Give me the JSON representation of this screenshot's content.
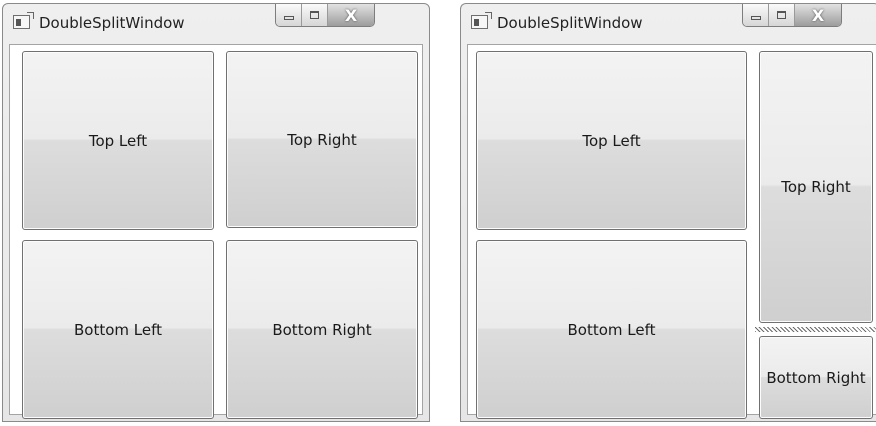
{
  "windows": [
    {
      "title": "DoubleSplitWindow",
      "buttons": {
        "top_left": "Top Left",
        "top_right": "Top Right",
        "bottom_left": "Bottom Left",
        "bottom_right": "Bottom Right"
      }
    },
    {
      "title": "DoubleSplitWindow",
      "buttons": {
        "top_left": "Top Left",
        "top_right": "Top Right",
        "bottom_left": "Bottom Left",
        "bottom_right": "Bottom Right"
      }
    }
  ],
  "caption_buttons": {
    "close_glyph": "X"
  },
  "icons": {
    "app": "window-app-icon",
    "minimize": "minimize-icon",
    "maximize": "maximize-icon",
    "close": "close-icon"
  }
}
